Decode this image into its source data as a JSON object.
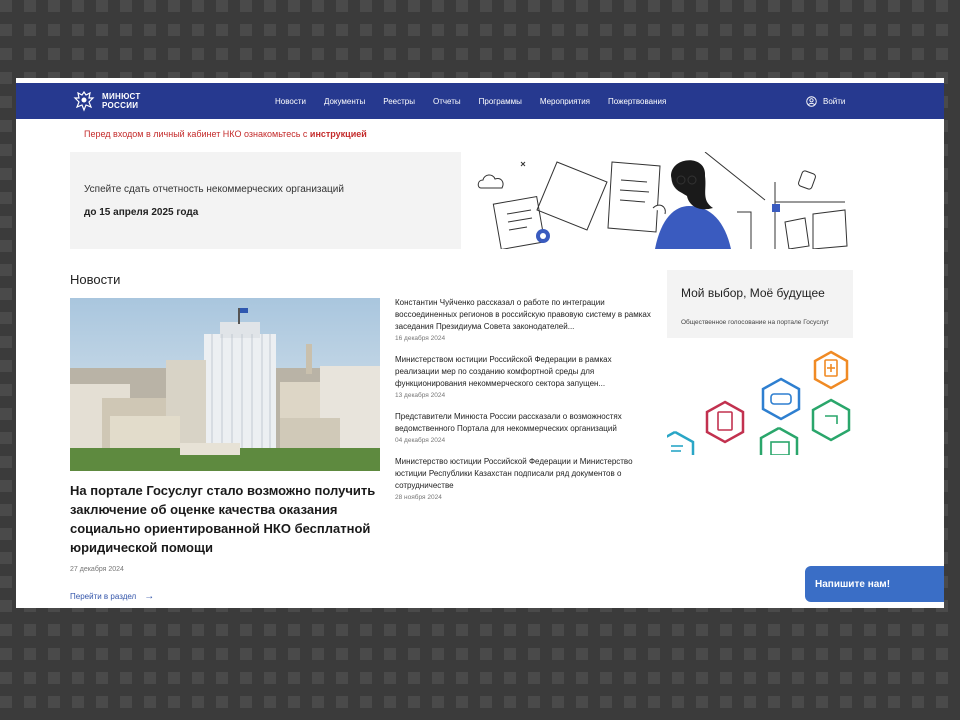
{
  "header": {
    "logo_line1": "МИНЮСТ",
    "logo_line2": "РОССИИ",
    "nav": [
      "Новости",
      "Документы",
      "Реестры",
      "Отчеты",
      "Программы",
      "Мероприятия",
      "Пожертвования"
    ],
    "login_label": "Войти",
    "brand_color": "#26398f"
  },
  "notice": {
    "text": "Перед входом в личный кабинет НКО ознакомьтесь с ",
    "link": "инструкцией"
  },
  "banner": {
    "line1": "Успейте сдать отчетность некоммерческих организаций",
    "line2": "до 15 апреля 2025 года"
  },
  "news": {
    "heading": "Новости",
    "main": {
      "title": "На портале Госуслуг стало возможно получить заключение об оценке качества оказания социально ориентированной НКО бесплатной юридической помощи",
      "date": "27 декабря 2024"
    },
    "goto_label": "Перейти в раздел",
    "items": [
      {
        "title": "Константин Чуйченко рассказал о работе по интеграции воссоединенных регионов в российскую правовую систему в рамках заседания Президиума Совета законодателей...",
        "date": "16 декабря 2024"
      },
      {
        "title": "Министерством юстиции Российской Федерации в рамках реализации мер по созданию комфортной среды для функционирования некоммерческого сектора запущен...",
        "date": "13 декабря 2024"
      },
      {
        "title": "Представители Минюста России рассказали о возможностях ведомственного Портала для некоммерческих организаций",
        "date": "04 декабря 2024"
      },
      {
        "title": "Министерство юстиции Российской Федерации и Министерство юстиции Республики Казахстан подписали ряд документов о сотрудничестве",
        "date": "28 ноября 2024"
      }
    ]
  },
  "promo": {
    "title": "Мой выбор, Моё будущее",
    "subtitle": "Общественное голосование на портале Госуслуг"
  },
  "chat_button": "Напишите нам!"
}
